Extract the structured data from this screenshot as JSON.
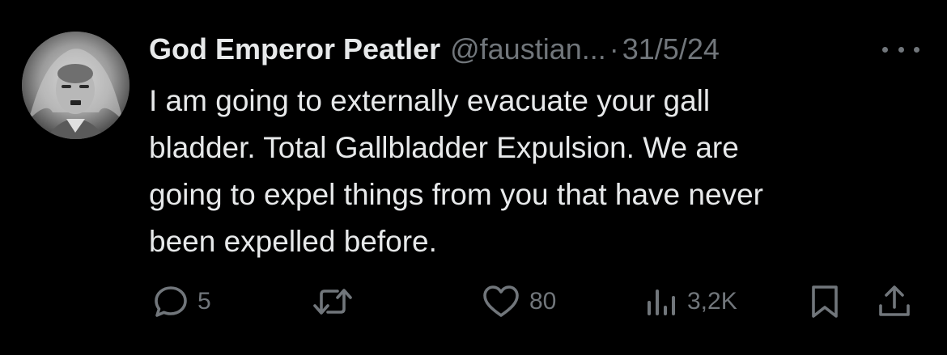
{
  "tweet": {
    "author": {
      "display_name": "God Emperor Peatler",
      "handle": "@faustian..."
    },
    "separator": "·",
    "date": "31/5/24",
    "text_lines": [
      "I am going to externally evacuate your gall",
      "bladder. Total Gallbladder Expulsion. We are",
      "going to expel things from you that have never",
      "been expelled before."
    ],
    "actions": {
      "replies": "5",
      "likes": "80",
      "views": "3,2K"
    }
  },
  "icons": {
    "reply": "speech-bubble-icon",
    "retweet": "retweet-arrows-icon",
    "like": "heart-icon",
    "views": "bar-chart-icon",
    "bookmark": "bookmark-icon",
    "share": "share-upload-icon",
    "more": "ellipsis-icon"
  },
  "colors": {
    "background": "#000000",
    "primary_text": "#e7e9ea",
    "secondary_text": "#71767b"
  }
}
